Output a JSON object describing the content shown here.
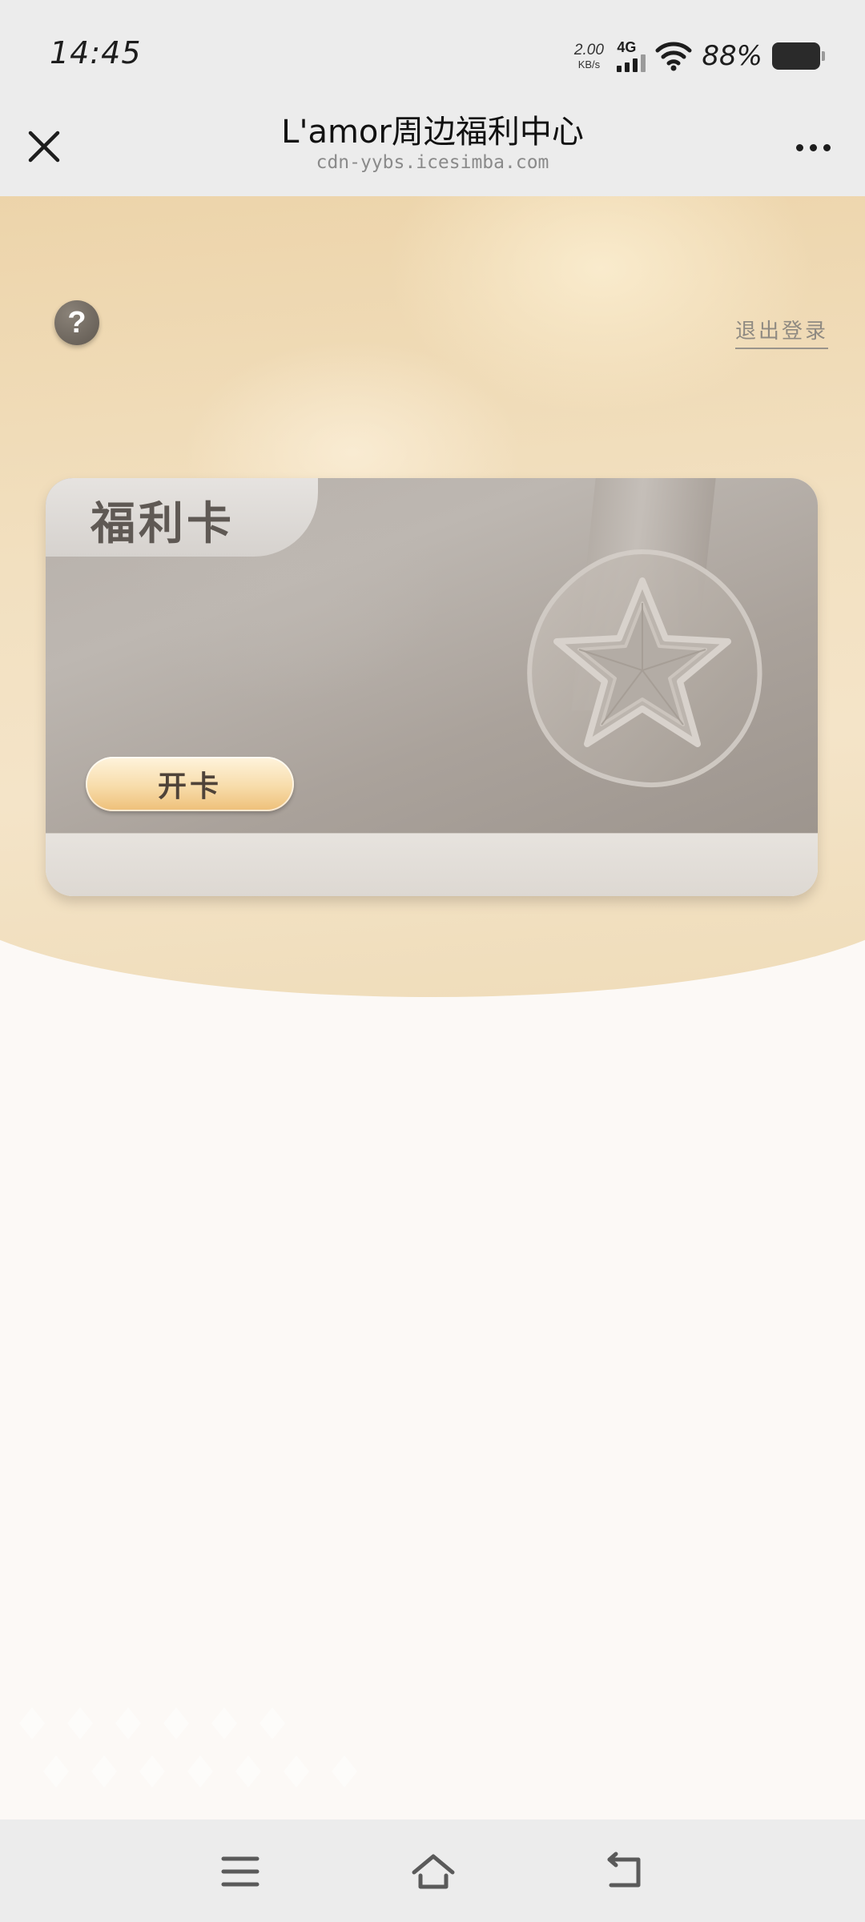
{
  "status_bar": {
    "time": "14:45",
    "net_speed_value": "2.00",
    "net_speed_unit": "KB/s",
    "network_type": "4G",
    "battery_percent": "88%",
    "icons": [
      "signal-icon",
      "wifi-icon",
      "battery-icon"
    ]
  },
  "title_bar": {
    "title": "L'amor周边福利中心",
    "url": "cdn-yybs.icesimba.com",
    "icons": [
      "close-icon",
      "more-icon"
    ]
  },
  "page": {
    "help_label": "?",
    "logout_label": "退出登录",
    "card": {
      "title": "福利卡",
      "open_button_label": "开卡",
      "emblem": "star-seal-icon"
    }
  },
  "nav_bar": {
    "icons": [
      "menu-icon",
      "home-icon",
      "back-icon"
    ]
  },
  "colors": {
    "hero_background": "#f0dcb8",
    "card_gray": "#b0a9a2",
    "button_gold": "#f3cf92",
    "system_bar": "#ececec"
  }
}
